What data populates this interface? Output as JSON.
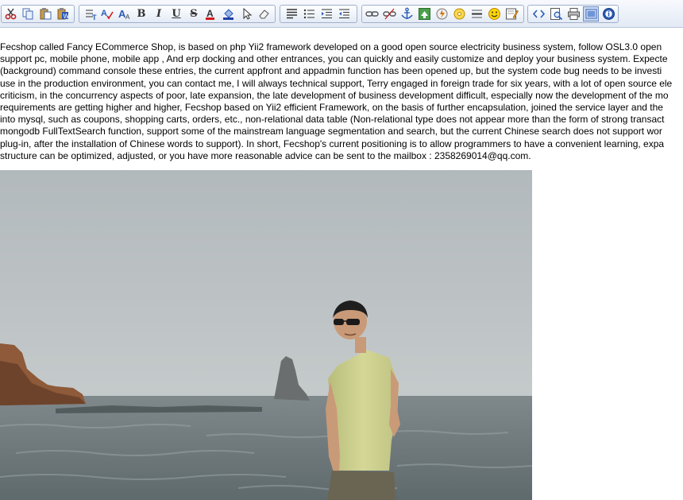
{
  "toolbar": {
    "groups": [
      "edit",
      "format",
      "paragraph",
      "insert",
      "view"
    ],
    "buttons": [
      {
        "name": "cut-icon",
        "glyph": "✂",
        "color": "#c02424"
      },
      {
        "name": "copy-icon"
      },
      {
        "name": "paste-icon"
      },
      {
        "name": "paste-word-icon"
      },
      {
        "name": "font-size-icon"
      },
      {
        "name": "spellcheck-icon"
      },
      {
        "name": "font-name-icon"
      },
      {
        "name": "bold-icon",
        "glyph": "B"
      },
      {
        "name": "italic-icon",
        "glyph": "I"
      },
      {
        "name": "underline-icon",
        "glyph": "U"
      },
      {
        "name": "strikethrough-icon",
        "glyph": "S"
      },
      {
        "name": "font-color-icon",
        "glyph": "A",
        "color": "#d11a1a"
      },
      {
        "name": "highlight-color-icon"
      },
      {
        "name": "select-all-icon"
      },
      {
        "name": "clear-format-icon"
      },
      {
        "name": "align-icon"
      },
      {
        "name": "bullet-list-icon"
      },
      {
        "name": "indent-icon"
      },
      {
        "name": "outdent-icon"
      },
      {
        "name": "link-icon"
      },
      {
        "name": "unlink-icon"
      },
      {
        "name": "anchor-icon"
      },
      {
        "name": "image-icon"
      },
      {
        "name": "flash-icon"
      },
      {
        "name": "media-icon"
      },
      {
        "name": "horizontal-rule-icon"
      },
      {
        "name": "emoticon-icon"
      },
      {
        "name": "edit-table-icon"
      },
      {
        "name": "source-code-icon"
      },
      {
        "name": "preview-icon"
      },
      {
        "name": "print-icon"
      },
      {
        "name": "fullscreen-icon"
      },
      {
        "name": "about-icon"
      }
    ]
  },
  "content": {
    "lines": [
      "Fecshop called Fancy ECommerce Shop, is based on php Yii2 framework developed on a good open source electricity business system, follow OSL3.0 open",
      "support pc, mobile phone, mobile app , And erp docking and other entrances, you can quickly and easily customize and deploy your business system. Expecte",
      "(background) command console these entries, the current appfront and appadmin function has been opened up, but the system code bug needs to be investi",
      "use in the production environment, you can contact me, I will always technical support, Terry engaged in foreign trade for six years, with a lot of open source ele",
      "criticism, in the concurrency aspects of poor, late expansion, the late development of business development difficult, especially now the development of the mo",
      "requirements are getting higher and higher, Fecshop based on Yii2 efficient Framework, on the basis of further encapsulation, joined the service layer and the",
      "into mysql, such as coupons, shopping carts, orders, etc., non-relational data table (Non-relational type does not appear more than the form of strong transact",
      "mongodb FullTextSearch function, support some of the mainstream language segmentation and search, but the current Chinese search does not support wor",
      "plug-in, after the installation of Chinese words to support). In short, Fecshop's current positioning is to allow programmers to have a convenient learning, expa",
      "structure can be optimized, adjusted, or you have more reasonable advice can be sent to the mailbox : 2358269014@qq.com."
    ]
  },
  "photo": {
    "subject": "man-on-beach",
    "sky_color": "#b9bfc2",
    "sea_color": "#6f7a7e",
    "shirt_color": "#cdd08e"
  }
}
